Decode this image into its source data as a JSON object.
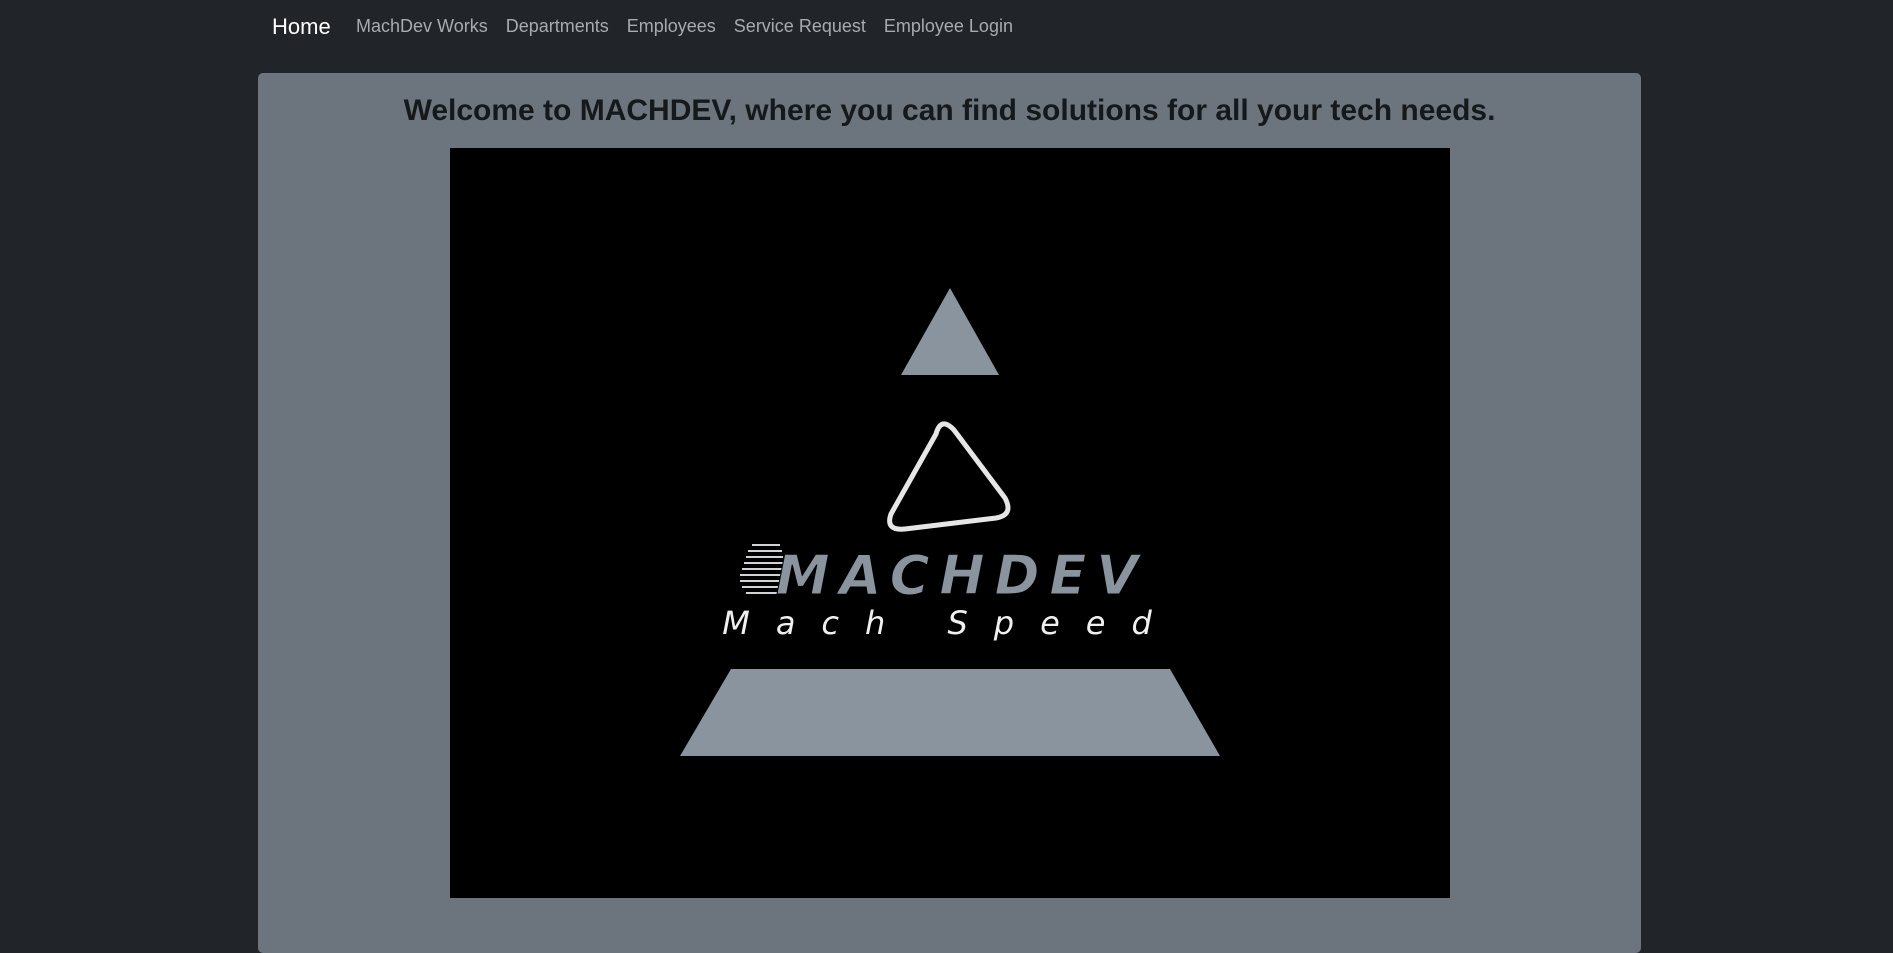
{
  "navbar": {
    "brand": "Home",
    "links": [
      "MachDev Works",
      "Departments",
      "Employees",
      "Service Request",
      "Employee Login"
    ]
  },
  "main": {
    "heading": "Welcome to MACHDEV, where you can find solutions for all your tech needs.",
    "logo": {
      "wordmark": "MACHDEV",
      "tagline": "Mach Speed"
    }
  },
  "colors": {
    "page_background": "#212529",
    "card_background": "#6c757d",
    "logo_background": "#000000",
    "logo_shape": "#8a949e"
  }
}
